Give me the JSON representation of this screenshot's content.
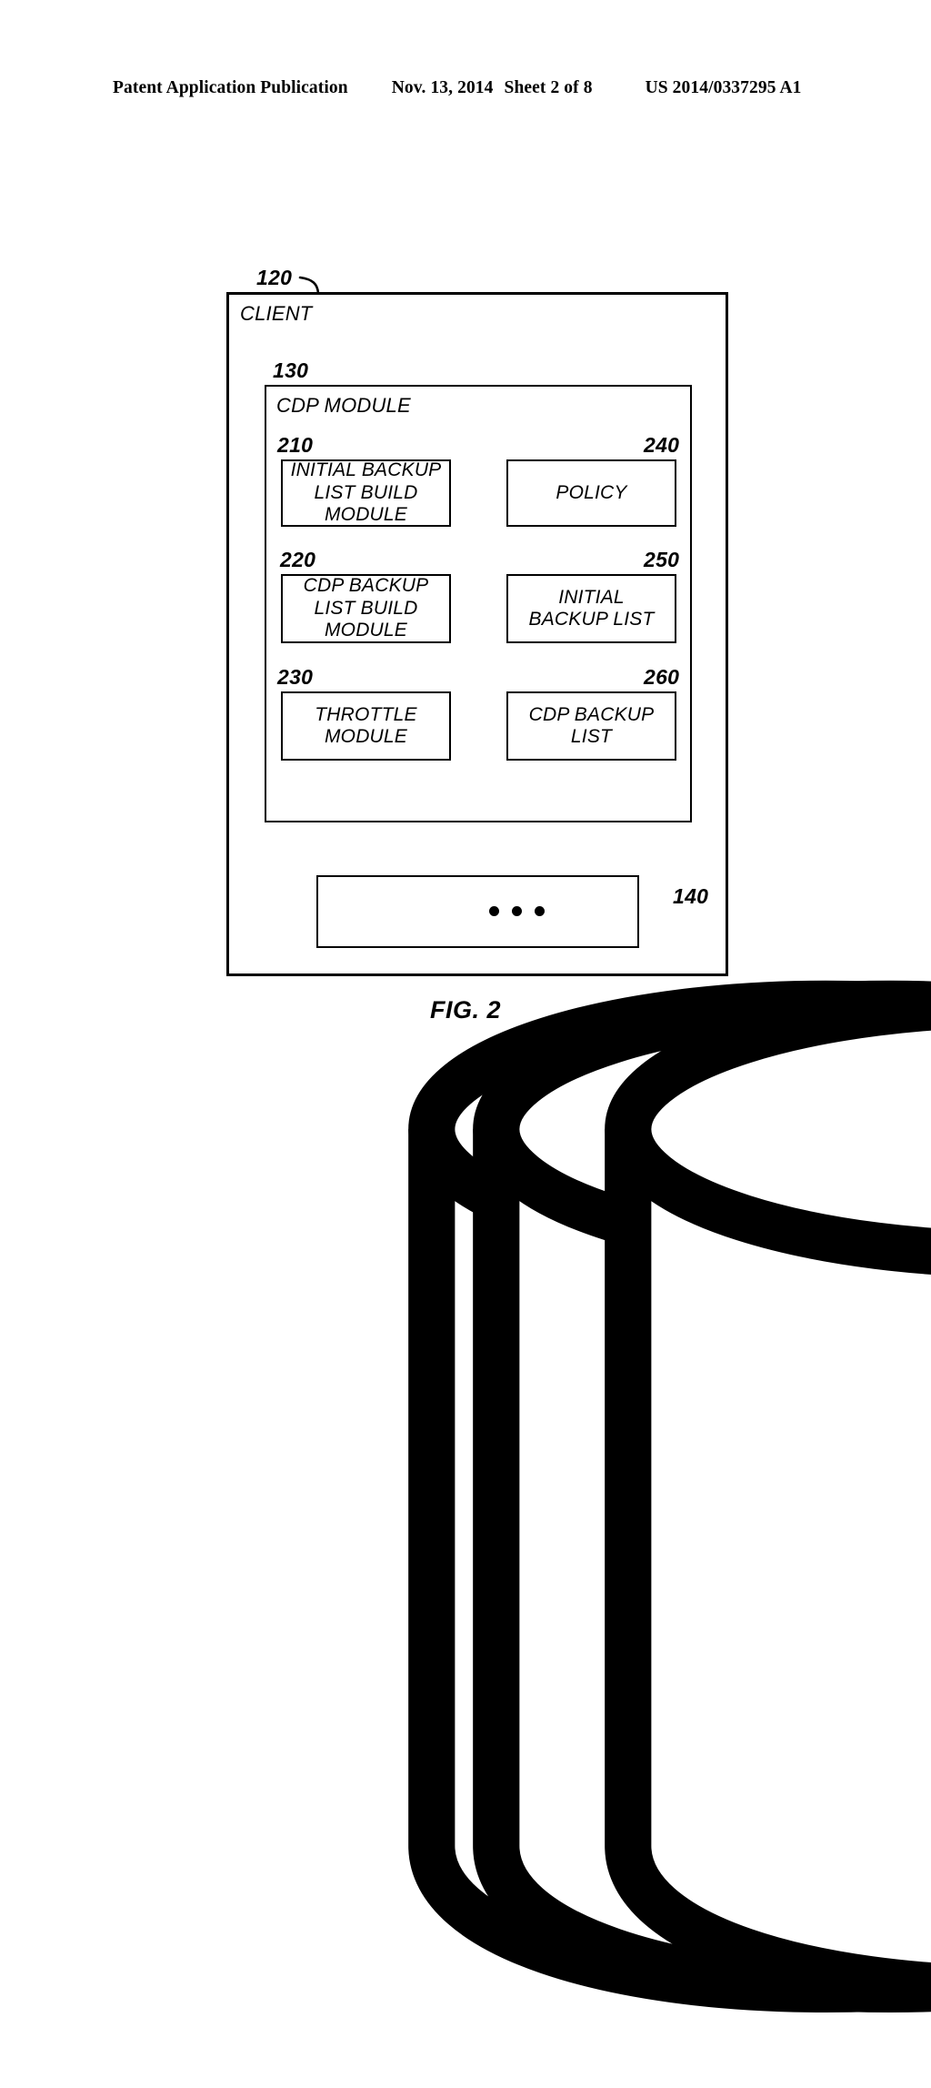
{
  "header": {
    "publication": "Patent Application Publication",
    "date": "Nov. 13, 2014",
    "sheet": "Sheet 2 of 8",
    "patent_number": "US 2014/0337295 A1"
  },
  "figure": {
    "caption": "FIG. 2",
    "client": {
      "ref": "120",
      "title": "CLIENT"
    },
    "cdp_module": {
      "ref": "130",
      "title": "CDP MODULE"
    },
    "blocks": [
      {
        "ref": "210",
        "label": "INITIAL BACKUP\nLIST BUILD\nMODULE"
      },
      {
        "ref": "240",
        "label": "POLICY"
      },
      {
        "ref": "220",
        "label": "CDP BACKUP\nLIST BUILD\nMODULE"
      },
      {
        "ref": "250",
        "label": "INITIAL\nBACKUP LIST"
      },
      {
        "ref": "230",
        "label": "THROTTLE\nMODULE"
      },
      {
        "ref": "260",
        "label": "CDP BACKUP\nLIST"
      }
    ],
    "storage": {
      "ref": "140",
      "disk_count": 3,
      "ellipsis": "•••"
    }
  }
}
